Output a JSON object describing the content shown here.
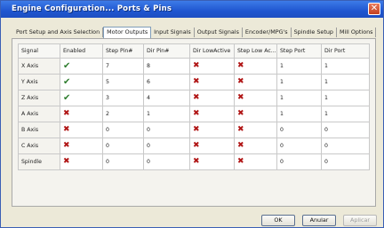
{
  "window": {
    "title": "Engine Configuration... Ports & Pins",
    "close_label": "✕"
  },
  "tabs": [
    {
      "label": "Port Setup and Axis Selection",
      "active": false
    },
    {
      "label": "Motor Outputs",
      "active": true
    },
    {
      "label": "Input Signals",
      "active": false
    },
    {
      "label": "Output Signals",
      "active": false
    },
    {
      "label": "Encoder/MPG's",
      "active": false
    },
    {
      "label": "Spindle Setup",
      "active": false
    },
    {
      "label": "Mill Options",
      "active": false
    }
  ],
  "table": {
    "columns": [
      "Signal",
      "Enabled",
      "Step Pin#",
      "Dir Pin#",
      "Dir LowActive",
      "Step Low Ac...",
      "Step Port",
      "Dir Port"
    ],
    "rows": [
      {
        "signal": "X Axis",
        "enabled": true,
        "step_pin": "7",
        "dir_pin": "8",
        "dir_low_active": false,
        "step_low_active": false,
        "step_port": "1",
        "dir_port": "1"
      },
      {
        "signal": "Y Axis",
        "enabled": true,
        "step_pin": "5",
        "dir_pin": "6",
        "dir_low_active": false,
        "step_low_active": false,
        "step_port": "1",
        "dir_port": "1"
      },
      {
        "signal": "Z Axis",
        "enabled": true,
        "step_pin": "3",
        "dir_pin": "4",
        "dir_low_active": false,
        "step_low_active": false,
        "step_port": "1",
        "dir_port": "1"
      },
      {
        "signal": "A Axis",
        "enabled": false,
        "step_pin": "2",
        "dir_pin": "1",
        "dir_low_active": false,
        "step_low_active": false,
        "step_port": "1",
        "dir_port": "1"
      },
      {
        "signal": "B Axis",
        "enabled": false,
        "step_pin": "0",
        "dir_pin": "0",
        "dir_low_active": false,
        "step_low_active": false,
        "step_port": "0",
        "dir_port": "0"
      },
      {
        "signal": "C Axis",
        "enabled": false,
        "step_pin": "0",
        "dir_pin": "0",
        "dir_low_active": false,
        "step_low_active": false,
        "step_port": "0",
        "dir_port": "0"
      },
      {
        "signal": "Spindle",
        "enabled": false,
        "step_pin": "0",
        "dir_pin": "0",
        "dir_low_active": false,
        "step_low_active": false,
        "step_port": "0",
        "dir_port": "0"
      }
    ]
  },
  "icons": {
    "enabled_true": "green-check-icon",
    "enabled_false": "red-x-icon",
    "check_glyph": "✔",
    "cross_glyph": "✖"
  },
  "footer": {
    "ok_label": "OK",
    "cancel_label": "Anular",
    "apply_label": "Aplicar"
  },
  "colors": {
    "titlebar": "#1f56d0",
    "check": "#2f7d2f",
    "cross": "#b01414"
  }
}
